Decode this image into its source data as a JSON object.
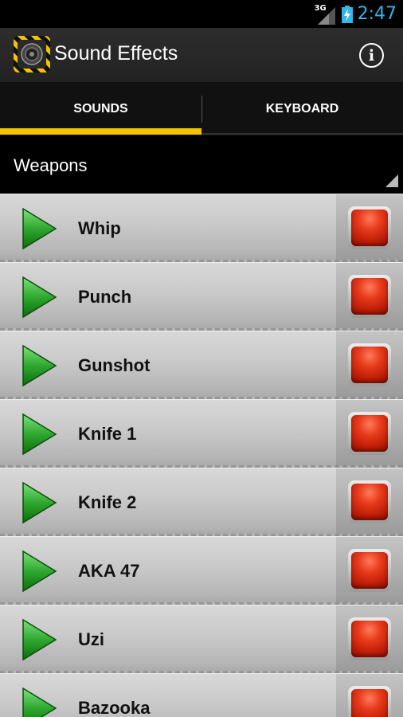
{
  "status_bar": {
    "network_label": "3G",
    "time": "2:47",
    "icons": [
      "signal-icon",
      "battery-charging-icon"
    ]
  },
  "action_bar": {
    "title": "Sound Effects",
    "app_icon": "speaker-icon",
    "info_icon": "info-icon",
    "info_glyph": "i"
  },
  "tabs": [
    {
      "label": "SOUNDS",
      "selected": true
    },
    {
      "label": "KEYBOARD",
      "selected": false
    }
  ],
  "category": {
    "selected": "Weapons"
  },
  "sounds": [
    {
      "label": "Whip"
    },
    {
      "label": "Punch"
    },
    {
      "label": "Gunshot"
    },
    {
      "label": "Knife 1"
    },
    {
      "label": "Knife 2"
    },
    {
      "label": "AKA 47"
    },
    {
      "label": "Uzi"
    },
    {
      "label": "Bazooka"
    }
  ],
  "colors": {
    "accent": "#f2c300",
    "clock": "#33b5e5",
    "play": "#2fa82f",
    "stop": "#e63a1a"
  }
}
